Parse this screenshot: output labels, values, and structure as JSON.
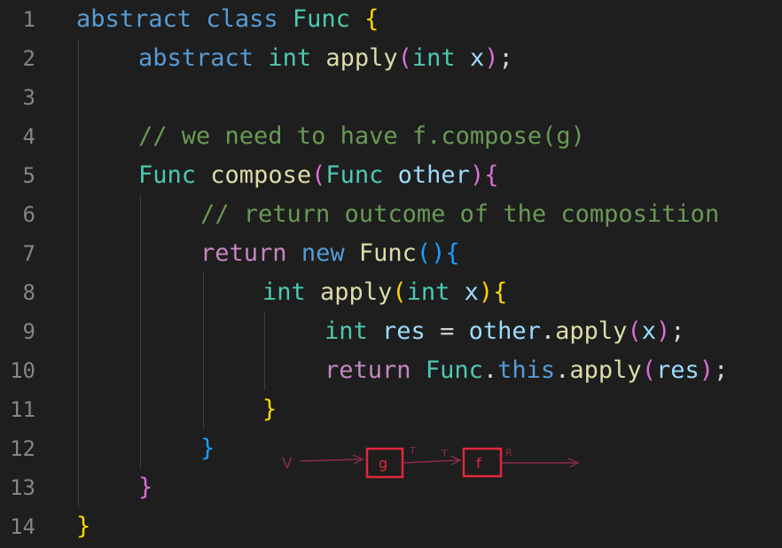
{
  "lines": [
    {
      "n": "1",
      "indent": 0,
      "tokens": [
        [
          "kw",
          "abstract"
        ],
        [
          "pn",
          " "
        ],
        [
          "kw",
          "class"
        ],
        [
          "pn",
          " "
        ],
        [
          "ty",
          "Func"
        ],
        [
          "pn",
          " "
        ],
        [
          "b1",
          "{"
        ]
      ]
    },
    {
      "n": "2",
      "indent": 1,
      "tokens": [
        [
          "kw",
          "abstract"
        ],
        [
          "pn",
          " "
        ],
        [
          "ty",
          "int"
        ],
        [
          "pn",
          " "
        ],
        [
          "fn",
          "apply"
        ],
        [
          "b2",
          "("
        ],
        [
          "ty",
          "int"
        ],
        [
          "pn",
          " "
        ],
        [
          "var",
          "x"
        ],
        [
          "b2",
          ")"
        ],
        [
          "pn",
          ";"
        ]
      ]
    },
    {
      "n": "3",
      "indent": 0,
      "tokens": []
    },
    {
      "n": "4",
      "indent": 1,
      "tokens": [
        [
          "cm",
          "// we need to have f.compose(g)"
        ]
      ]
    },
    {
      "n": "5",
      "indent": 1,
      "tokens": [
        [
          "ty",
          "Func"
        ],
        [
          "pn",
          " "
        ],
        [
          "fn",
          "compose"
        ],
        [
          "b2",
          "("
        ],
        [
          "ty",
          "Func"
        ],
        [
          "pn",
          " "
        ],
        [
          "var",
          "other"
        ],
        [
          "b2",
          ")"
        ],
        [
          "b2",
          "{"
        ]
      ]
    },
    {
      "n": "6",
      "indent": 2,
      "tokens": [
        [
          "cm",
          "// return outcome of the composition"
        ]
      ]
    },
    {
      "n": "7",
      "indent": 2,
      "tokens": [
        [
          "kw2",
          "return"
        ],
        [
          "pn",
          " "
        ],
        [
          "kw",
          "new"
        ],
        [
          "pn",
          " "
        ],
        [
          "fn",
          "Func"
        ],
        [
          "b3",
          "()"
        ],
        [
          "b3",
          "{"
        ]
      ]
    },
    {
      "n": "8",
      "indent": 3,
      "tokens": [
        [
          "ty",
          "int"
        ],
        [
          "pn",
          " "
        ],
        [
          "fn",
          "apply"
        ],
        [
          "b1",
          "("
        ],
        [
          "ty",
          "int"
        ],
        [
          "pn",
          " "
        ],
        [
          "var",
          "x"
        ],
        [
          "b1",
          ")"
        ],
        [
          "b1",
          "{"
        ]
      ]
    },
    {
      "n": "9",
      "indent": 4,
      "tokens": [
        [
          "ty",
          "int"
        ],
        [
          "pn",
          " "
        ],
        [
          "var",
          "res"
        ],
        [
          "pn",
          " = "
        ],
        [
          "var",
          "other"
        ],
        [
          "pn",
          "."
        ],
        [
          "fn",
          "apply"
        ],
        [
          "b2",
          "("
        ],
        [
          "var",
          "x"
        ],
        [
          "b2",
          ")"
        ],
        [
          "pn",
          ";"
        ]
      ]
    },
    {
      "n": "10",
      "indent": 4,
      "tokens": [
        [
          "kw2",
          "return"
        ],
        [
          "pn",
          " "
        ],
        [
          "ty",
          "Func"
        ],
        [
          "pn",
          "."
        ],
        [
          "kw",
          "this"
        ],
        [
          "pn",
          "."
        ],
        [
          "fn",
          "apply"
        ],
        [
          "b2",
          "("
        ],
        [
          "var",
          "res"
        ],
        [
          "b2",
          ")"
        ],
        [
          "pn",
          ";"
        ]
      ]
    },
    {
      "n": "11",
      "indent": 3,
      "tokens": [
        [
          "b1",
          "}"
        ]
      ]
    },
    {
      "n": "12",
      "indent": 2,
      "tokens": [
        [
          "b3",
          "}"
        ]
      ]
    },
    {
      "n": "13",
      "indent": 1,
      "tokens": [
        [
          "b2",
          "}"
        ]
      ]
    },
    {
      "n": "14",
      "indent": 0,
      "tokens": [
        [
          "b1",
          "}"
        ]
      ]
    }
  ],
  "annotation": {
    "input_label": "V",
    "box1_label": "g",
    "mid_label_1": "T",
    "mid_label_2": "T",
    "box2_label": "f",
    "output_label": "R",
    "ink_color": "#8a2a4a",
    "box_color": "#e0283a"
  },
  "colors": {
    "background": "#1e1e1e",
    "line_number": "#858585",
    "keyword": "#569cd6",
    "control_keyword": "#c586c0",
    "type": "#4ec9b0",
    "function": "#dcdcaa",
    "variable": "#9cdcfe",
    "comment": "#6a9955"
  }
}
